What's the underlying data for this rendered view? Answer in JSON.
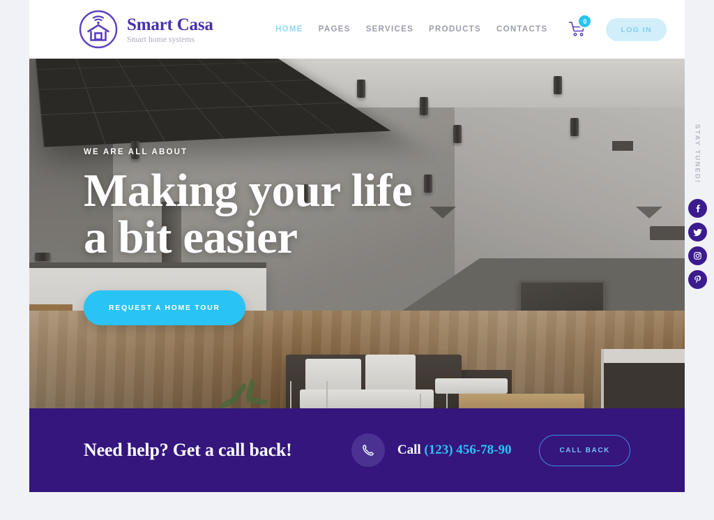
{
  "brand": {
    "name": "Smart Casa",
    "tagline": "Smart home systems",
    "logo_icon": "smart-home-wifi-icon",
    "accent_purple": "#4930b0"
  },
  "nav": {
    "items": [
      {
        "label": "HOME",
        "active": true
      },
      {
        "label": "PAGES",
        "active": false
      },
      {
        "label": "SERVICES",
        "active": false
      },
      {
        "label": "PRODUCTS",
        "active": false
      },
      {
        "label": "CONTACTS",
        "active": false
      }
    ]
  },
  "header": {
    "cart_icon": "shopping-cart-icon",
    "cart_count": "0",
    "login_label": "LOG IN",
    "login_bg": "#d2eefb"
  },
  "hero": {
    "eyebrow": "WE ARE ALL ABOUT",
    "title_line1": "Making your life",
    "title_line2": "a bit easier",
    "cta_label": "REQUEST A HOME TOUR",
    "cta_color": "#2ac3f5",
    "image_description": "modern smart living room with dark grid ceiling panel, recessed ceiling spotlights, wall-mounted flat screen TV, dark chaise sofa with white cushions, glass and wood coffee table, and glossy hardwood floor"
  },
  "callback": {
    "heading": "Need help? Get a call back!",
    "phone_icon": "phone-handset-icon",
    "call_prefix": "Call",
    "phone_number": "(123) 456-78-90",
    "button_label": "CALL BACK",
    "bar_color": "#34167d",
    "number_color": "#2ac3f5"
  },
  "social_rail": {
    "label": "STAY TUNED!",
    "items": [
      {
        "name": "facebook-icon",
        "glyph": "f"
      },
      {
        "name": "twitter-icon",
        "glyph": "t"
      },
      {
        "name": "instagram-icon",
        "glyph": "i"
      },
      {
        "name": "pinterest-icon",
        "glyph": "p"
      }
    ],
    "icon_color": "#3b1b8e"
  }
}
